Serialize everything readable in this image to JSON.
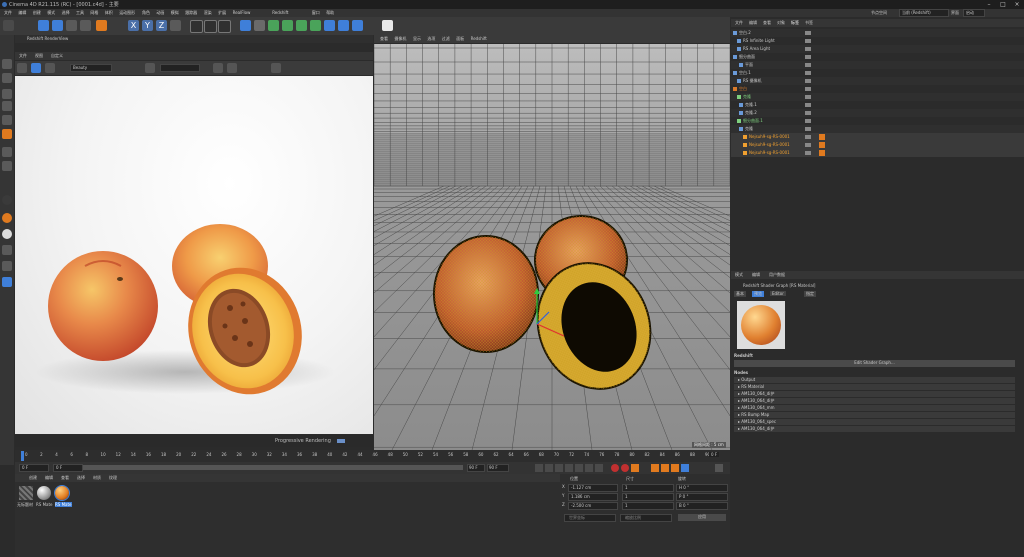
{
  "window": {
    "title": "Cinema 4D R21.115 (RC) - [0001.c4d] - 主要"
  },
  "menu": [
    "文件",
    "编辑",
    "创建",
    "模式",
    "选择",
    "工具",
    "网格",
    "体积",
    "运动图形",
    "角色",
    "动画",
    "模拟",
    "跟踪器",
    "渲染",
    "扩展",
    "RealFlow",
    "Redshift",
    "窗口",
    "帮助"
  ],
  "toolbar": {
    "axes": [
      "X",
      "Y",
      "Z"
    ]
  },
  "render_view": {
    "title": "Redshift RenderView",
    "menu": [
      "文件",
      "视图",
      "自定义"
    ],
    "mode": "Beauty",
    "status": "Progressive Rendering"
  },
  "viewport": {
    "menu": [
      "查看",
      "摄像机",
      "显示",
      "选项",
      "过滤",
      "面板",
      "Redshift"
    ],
    "status": "网格间距 : 5 cm"
  },
  "timeline": {
    "ticks": [
      "0",
      "2",
      "4",
      "6",
      "8",
      "10",
      "12",
      "14",
      "16",
      "18",
      "20",
      "22",
      "24",
      "26",
      "28",
      "30",
      "32",
      "34",
      "36",
      "38",
      "40",
      "42",
      "44",
      "46",
      "48",
      "50",
      "52",
      "54",
      "56",
      "58",
      "60",
      "62",
      "64",
      "66",
      "68",
      "70",
      "72",
      "74",
      "76",
      "78",
      "80",
      "82",
      "84",
      "86",
      "88",
      "90"
    ],
    "current_frame": "0 F"
  },
  "transport": {
    "start": "0 F",
    "min": "0 F",
    "end": "90 F",
    "max": "90 F"
  },
  "materials": {
    "menu": [
      "创建",
      "编辑",
      "查看",
      "选择",
      "材质",
      "纹理"
    ],
    "items": [
      {
        "label": "无标题材"
      },
      {
        "label": "RS Mate"
      },
      {
        "label": "RS Mate"
      }
    ]
  },
  "coords": {
    "headers": [
      "位置",
      "尺寸",
      "旋转"
    ],
    "rows": [
      {
        "axis": "X",
        "pos": "-1.127 cm",
        "size": "1",
        "rot": "H 0 °"
      },
      {
        "axis": "Y",
        "pos": "1.186 cm",
        "size": "1",
        "rot": "P 0 °"
      },
      {
        "axis": "Z",
        "pos": "-2.500 cm",
        "size": "1",
        "rot": "B 0 °"
      }
    ],
    "mode1": "世界坐标",
    "mode2": "缩放比例",
    "apply": "应用"
  },
  "layout": {
    "label": "节点空间",
    "value": "当前 (Redshift)",
    "label2": "界面",
    "value2": "启动"
  },
  "objects": {
    "tabs": [
      "文件",
      "编辑",
      "查看",
      "对象",
      "标签",
      "书签"
    ],
    "rows": [
      {
        "name": "空白.2",
        "color": "#c8c8c8",
        "indent": 8
      },
      {
        "name": "RS Infinite Light",
        "color": "#c8c8c8",
        "indent": 12
      },
      {
        "name": "RS Area Light",
        "color": "#c8c8c8",
        "indent": 12
      },
      {
        "name": "细分曲面",
        "color": "#c8c8c8",
        "indent": 8
      },
      {
        "name": "平面",
        "color": "#c8c8c8",
        "indent": 14
      },
      {
        "name": "空白.1",
        "color": "#c8c8c8",
        "indent": 8
      },
      {
        "name": "RS 摄像机",
        "color": "#c8c8c8",
        "indent": 12
      },
      {
        "name": "空白",
        "color": "#d87a2a",
        "indent": 8
      },
      {
        "name": "克隆",
        "color": "#7ed07e",
        "indent": 12
      },
      {
        "name": "克隆.1",
        "color": "#c8c8c8",
        "indent": 14
      },
      {
        "name": "克隆.2",
        "color": "#c8c8c8",
        "indent": 14
      },
      {
        "name": "细分曲面.1",
        "color": "#7ed07e",
        "indent": 12
      },
      {
        "name": "克隆",
        "color": "#c8c8c8",
        "indent": 14
      },
      {
        "name": "Nejsuh9-sg-RS-0001",
        "color": "#f0a030",
        "indent": 18
      },
      {
        "name": "Nejsuh9-sg-RS-0001",
        "color": "#f0a030",
        "indent": 18
      },
      {
        "name": "Nejsuh9-sg-RS-0001",
        "color": "#f0a030",
        "indent": 18
      }
    ]
  },
  "attributes": {
    "tabs": [
      "模式",
      "编辑",
      "用户数据"
    ],
    "title": "Redshift Shader Graph [RS Material]",
    "subtabs": [
      "基本",
      "预览",
      "Editor",
      "指定"
    ],
    "section": "Redshift",
    "button": "Edit Shader Graph...",
    "nodes_label": "Nodes",
    "nodes": [
      "▸ Output",
      "▸ RS Material",
      "▸ AM130_064_di护",
      "▸ AM130_064_di护",
      "▸ AM130_064_mm",
      "▸ RS Bump Map",
      "▸ AM130_064_spec",
      "▸ AM130_064_di护"
    ]
  },
  "colors": {
    "accent": "#3f7fd9",
    "orange": "#e07a1f",
    "peach_red": "#d64a2a",
    "peach_yellow": "#f2b43a"
  }
}
